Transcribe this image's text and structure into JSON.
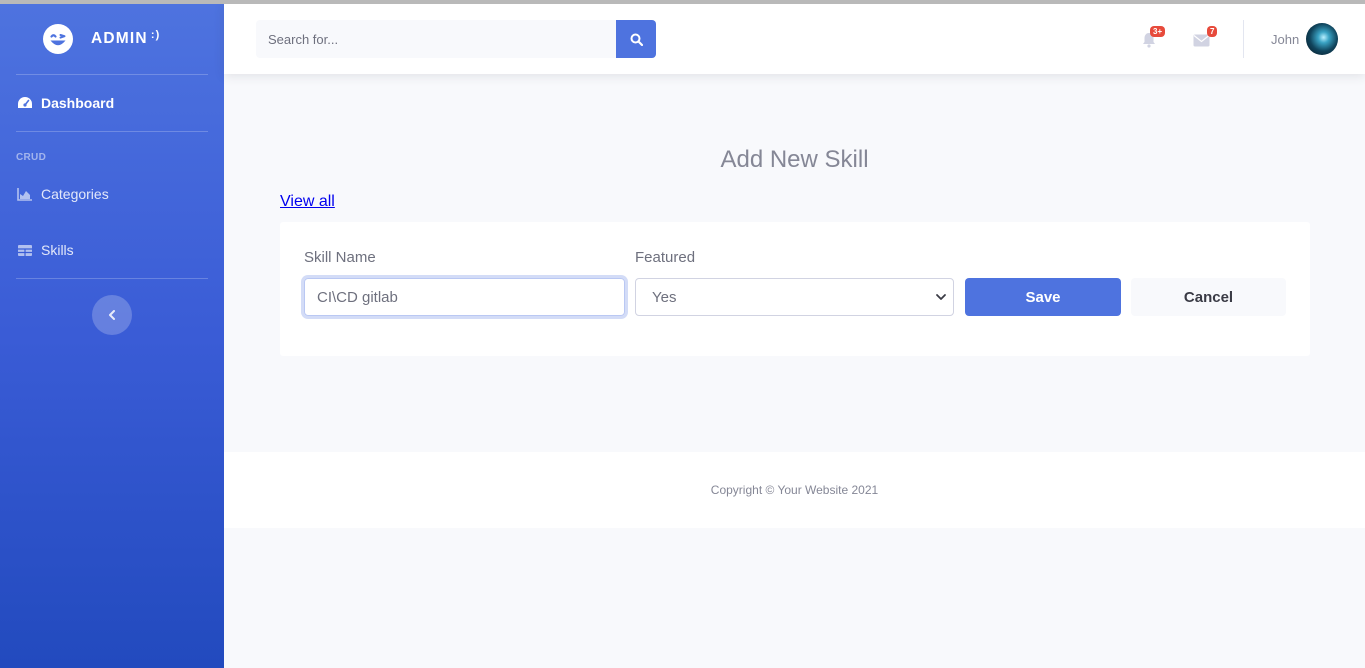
{
  "brand": {
    "name": "ADMIN",
    "suffix": ":)"
  },
  "sidebar": {
    "items": [
      {
        "label": "Dashboard",
        "icon": "tachometer-icon",
        "active": true
      },
      {
        "label": "Categories",
        "icon": "area-chart-icon"
      },
      {
        "label": "Skills",
        "icon": "table-icon"
      }
    ],
    "heading": "CRUD"
  },
  "topbar": {
    "search_placeholder": "Search for...",
    "alerts_badge": "3+",
    "messages_badge": "7",
    "username": "John"
  },
  "main": {
    "title": "Add New Skill",
    "view_all_link": "View all",
    "form": {
      "skill_name_label": "Skill Name",
      "skill_name_value": "CI\\CD gitlab",
      "featured_label": "Featured",
      "featured_value": "Yes",
      "save_label": "Save",
      "cancel_label": "Cancel"
    }
  },
  "footer": {
    "copyright": "Copyright © Your Website 2021"
  },
  "colors": {
    "primary": "#4e73df",
    "danger": "#e74a3b",
    "text_muted": "#858796"
  }
}
